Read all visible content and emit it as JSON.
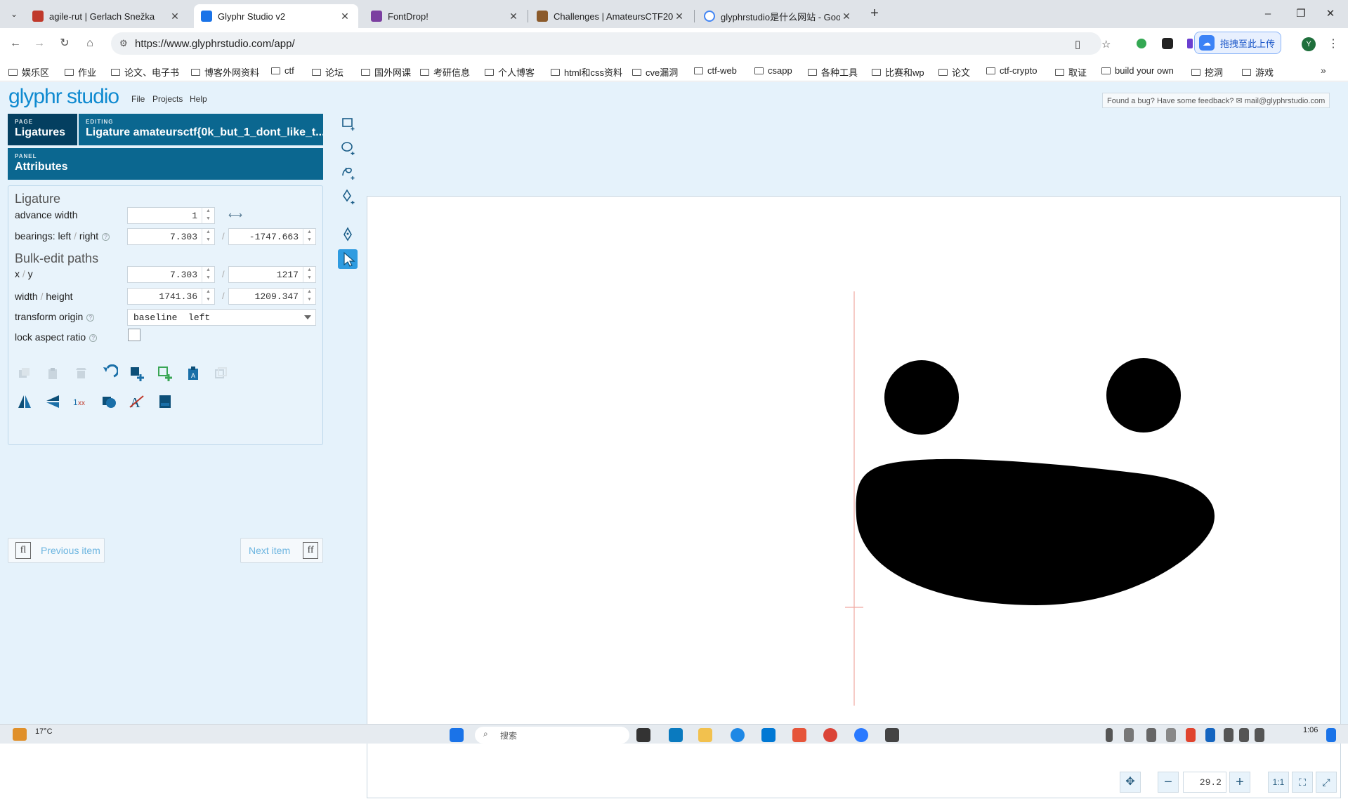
{
  "browser": {
    "tabs": [
      {
        "title": "agile-rut | Gerlach Snežka",
        "favicon_color": "#c0392b"
      },
      {
        "title": "Glyphr Studio v2",
        "favicon_color": "#1a73e8"
      },
      {
        "title": "FontDrop!",
        "favicon_color": "#7b3fa0"
      },
      {
        "title": "Challenges | AmateursCTF20",
        "favicon_color": "#8b5a2b"
      },
      {
        "title": "glyphrstudio是什么网站 - Goo",
        "favicon_color": "#4285f4"
      }
    ],
    "active_tab_index": 1,
    "url": "https://www.glyphrstudio.com/app/",
    "upload_button": "拖拽至此上传",
    "profile_initial": "Y",
    "bookmarks": [
      "娱乐区",
      "作业",
      "论文、电子书",
      "博客外网资料",
      "ctf",
      "论坛",
      "国外网课",
      "考研信息",
      "个人博客",
      "html和css资料",
      "cve漏洞",
      "ctf-web",
      "csapp",
      "各种工具",
      "比赛和wp",
      "论文",
      "ctf-crypto",
      "取证",
      "build your own",
      "挖洞",
      "游戏"
    ]
  },
  "app": {
    "logo": "glyphr studio",
    "menu": [
      "File",
      "Projects",
      "Help"
    ],
    "feedback": {
      "text": "Found a bug? Have some feedback?",
      "email": "mail@glyphrstudio.com"
    },
    "nav": {
      "page_label": "PAGE",
      "page_value": "Ligatures",
      "editing_label": "EDITING",
      "editing_value": "Ligature amateursctf{0k_but_1_dont_like_t...",
      "panel_label": "PANEL",
      "panel_value": "Attributes"
    },
    "attributes": {
      "section_ligature": "Ligature",
      "advance_width_label": "advance width",
      "advance_width": "1",
      "bearings_label_left": "bearings: left",
      "bearings_label_sep": "/",
      "bearings_label_right": "right",
      "bearing_left": "7.303",
      "bearing_right": "-1747.663",
      "section_bulk": "Bulk-edit paths",
      "xy_label_x": "x",
      "xy_label_y": "y",
      "x": "7.303",
      "y": "1217",
      "wh_label_w": "width",
      "wh_label_h": "height",
      "width": "1741.36",
      "height": "1209.347",
      "transform_origin_label": "transform origin",
      "transform_origin": "baseline  left",
      "lock_aspect_label": "lock aspect ratio",
      "lock_aspect": false
    },
    "prev_item": {
      "label": "Previous item",
      "glyph": "fl"
    },
    "next_item": {
      "label": "Next item",
      "glyph": "ff"
    },
    "zoom": "29.2"
  },
  "taskbar": {
    "temperature": "17°C",
    "search_placeholder": "搜索",
    "time": "1:06"
  }
}
